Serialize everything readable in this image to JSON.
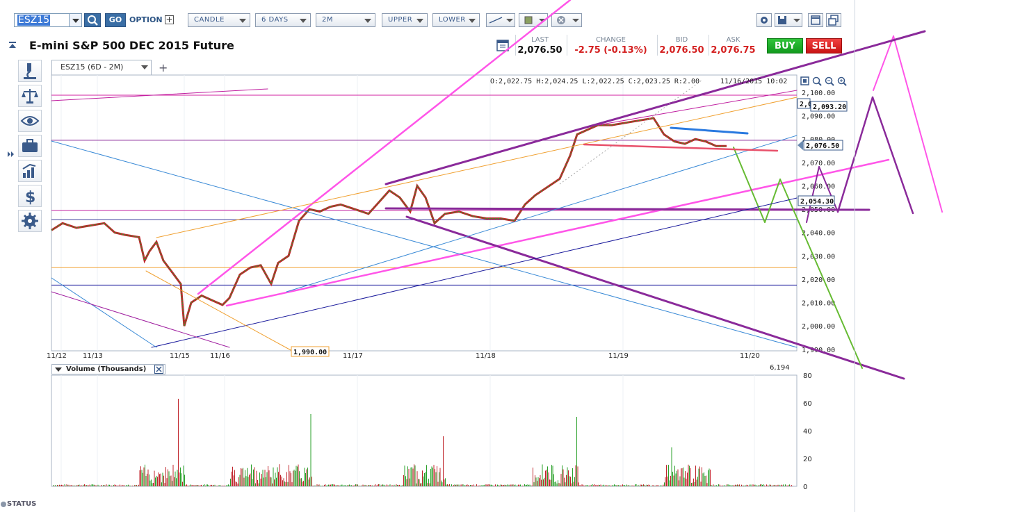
{
  "toolbar": {
    "symbol": "ESZ15",
    "go_label": "GO",
    "option_label": "OPTION",
    "chart_type": "CANDLE",
    "range": "6 DAYS",
    "interval": "2M",
    "upper": "UPPER",
    "lower": "LOWER"
  },
  "header": {
    "title": "E-mini S&P 500 DEC 2015 Future",
    "quote": {
      "last_label": "LAST",
      "last": "2,076.50",
      "change_label": "CHANGE",
      "change": "-2.75 (-0.13%)",
      "bid_label": "BID",
      "bid": "2,076.50",
      "ask_label": "ASK",
      "ask": "2,076.75"
    },
    "buy_label": "BUY",
    "sell_label": "SELL"
  },
  "tab": {
    "label": "ESZ15 (6D - 2M)",
    "add": "+"
  },
  "ohlc": "O:2,022.75 H:2,024.25 L:2,022.25 C:2,023.25 R:2.00",
  "timestamp": "11/16/2015 10:02",
  "price_axis": [
    "2,100.00",
    "2,090.00",
    "2,080.00",
    "2,070.00",
    "2,060.00",
    "2,050.00",
    "2,040.00",
    "2,030.00",
    "2,020.00",
    "2,010.00",
    "2,000.00",
    "1,990.00"
  ],
  "price_tags": {
    "top": "2,093.20",
    "last": "2,076.50",
    "mid": "2,054.30",
    "cut": "2,0",
    "low": "1,990.00"
  },
  "date_axis": [
    "11/12",
    "11/13",
    "11/15",
    "11/16",
    "11/17",
    "11/18",
    "11/19",
    "11/20"
  ],
  "volume": {
    "label": "Volume (Thousands)",
    "last": "6,194",
    "axis": [
      "80",
      "60",
      "40",
      "20",
      "0"
    ]
  },
  "status_label": "STATUS",
  "colors": {
    "up": "#2aa02a",
    "down": "#c0262c",
    "pink": "#ff55e8",
    "purple": "#8a2a9a",
    "green": "#66bb33",
    "navy": "#1a1a9c",
    "orange": "#f0a030",
    "blue": "#3a8ad6",
    "red": "#e8506a"
  },
  "icons": [
    "search-icon",
    "microscope-icon",
    "balance-icon",
    "eye-icon",
    "briefcase-icon",
    "bar-growth-icon",
    "dollar-icon",
    "gear-icon",
    "save-icon",
    "window-icon",
    "popout-icon",
    "zoom-in-icon",
    "zoom-out-icon",
    "zoom-fit-icon",
    "calendar-icon"
  ],
  "chart_data": {
    "type": "line",
    "title": "E-mini S&P 500 DEC 2015 Future",
    "symbol": "ESZ15",
    "x": [
      "11/12",
      "11/13",
      "11/15",
      "11/16",
      "11/17",
      "11/18",
      "11/19",
      "11/20"
    ],
    "ylim": [
      1990,
      2100
    ],
    "series": [
      {
        "name": "ESZ15",
        "x": [
          "11/12",
          "11/13",
          "11/15",
          "11/16",
          "11/17",
          "11/18",
          "11/19",
          "11/20"
        ],
        "values": [
          2043,
          2036,
          2000,
          2012,
          2055,
          2044,
          2087,
          2076.5
        ]
      }
    ],
    "volume_ylim": [
      0,
      80
    ],
    "grid": true
  }
}
